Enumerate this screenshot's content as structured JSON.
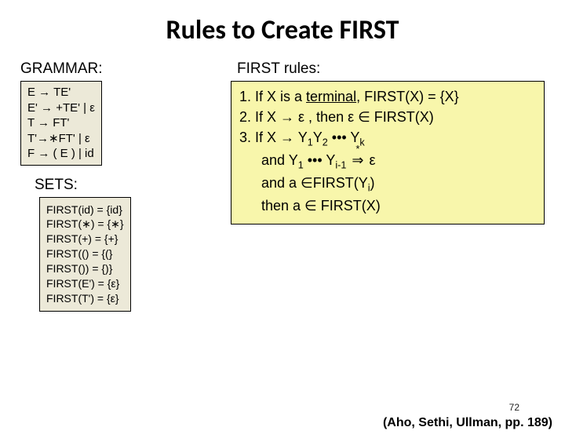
{
  "title": "Rules to Create FIRST",
  "left": {
    "grammar_label": "GRAMMAR:",
    "grammar": [
      "E  → TE'",
      "E' → +TE' | ε",
      "T  → FT'",
      "T'→∗FT' | ε",
      "F  → ( E ) | id"
    ],
    "sets_label": "SETS:",
    "sets": [
      "FIRST(id) = {id}",
      "FIRST(∗) = {∗}",
      "FIRST(+) = {+}",
      "FIRST(() = {(}",
      "FIRST()) = {)}",
      "FIRST(E') = {ε}",
      "FIRST(T') = {ε}"
    ]
  },
  "right": {
    "rules_label": "FIRST rules:",
    "rule1_pre": "1. If X is a ",
    "rule1_term": "terminal",
    "rule1_post": ", FIRST(X) = {X}",
    "rule2": "2. If X → ε , then ε ∈ FIRST(X)",
    "rule3_l1a": "3. If X → Y",
    "rule3_l1b": "Y",
    "rule3_l1c": " ••• Y",
    "rule3_l2a": "and Y",
    "rule3_l2b": " ••• Y",
    "rule3_l2c": " ε",
    "rule3_l3": "and a ∈FIRST(Y",
    "rule3_l3_end": ")",
    "rule3_l4": "then a ∈ FIRST(X)"
  },
  "sub": {
    "one": "1",
    "two": "2",
    "k": "k",
    "im1": "i-1",
    "i": "i"
  },
  "arrow": {
    "glyph": "⇒",
    "star": "*"
  },
  "footer": {
    "page": "72",
    "cite": "(Aho, Sethi, Ullman, pp. 189)"
  }
}
